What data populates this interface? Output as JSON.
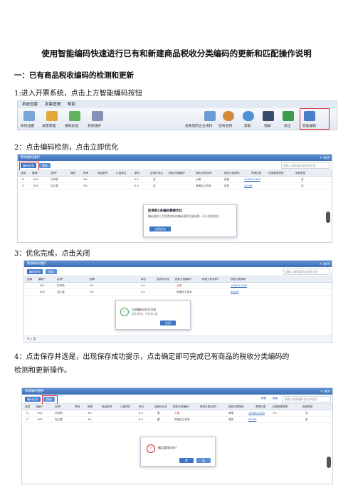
{
  "doc": {
    "title": "使用智能编码快速进行已有和新建商品税收分类编码的更新和匹配操作说明",
    "section1": "一：已有商品税收编码的检测和更新",
    "step1": "1:进入开票系统，点击上方智能编码按钮",
    "step2": "2：点击编码检测，点击立即优化",
    "step3": "3：优化完成，点击关闭",
    "step4_line1": "4：点击保存并选是，出现保存成功提示，点击确定即可完成已有商品的税收分类编码的",
    "step4_line2": "检测和更新操作。"
  },
  "shot1": {
    "menus": [
      "系统设置",
      "发票管理",
      "帮助"
    ],
    "tabs": [
      "系统设置",
      "发票管理",
      "报税处理",
      "系统维护"
    ],
    "right_buttons": [
      "查看我的企业资料",
      "在线支持",
      "帮助",
      "锁屏",
      "退出",
      "智能编码"
    ]
  },
  "grid": {
    "window_title": "税收编码维护",
    "close": "✕ 关闭",
    "headers": [
      "选择",
      "编码*",
      "名称*",
      "简码",
      "税率",
      "商品型号",
      "计量单位",
      "单价",
      "含税价标志",
      "税收分类编码*",
      "税收分类名称*",
      "税收分类简码",
      "享受优惠",
      "优惠政策类型",
      "免税类型"
    ],
    "rows": [
      {
        "code": "001",
        "name": "打印机",
        "rate": "3%",
        "price": "0.0",
        "flag": "否",
        "tax_name": "大类",
        "short": "其他",
        "tax_code": "1090511399"
      },
      {
        "code": "002",
        "name": "加工费",
        "rate": "3%",
        "price": "0.0",
        "flag": "否",
        "tax_name": "其他加工劳务",
        "short": "劳务",
        "tax_code": "30199"
      }
    ],
    "check_button": "编码检测",
    "save_button": "保存",
    "search_placeholder": "请输入搜索编码或名称信息",
    "refresh": "刷新",
    "filter": "高级",
    "footer": "共 2 条",
    "cn_marks": [
      "是",
      "否"
    ]
  },
  "dialog2": {
    "title": "检测到1条编码需要优化",
    "body": "编码维护已为您提供新的编码规则匹配结果，可以立即优化！",
    "button": "立即优化"
  },
  "dialog3": {
    "text1": "当前编码优化已完成",
    "text2": "优化完成，共优化1条",
    "button": "关闭"
  },
  "dialog4": {
    "text": "确定要保存吗?",
    "yes": "是",
    "no": "否"
  }
}
